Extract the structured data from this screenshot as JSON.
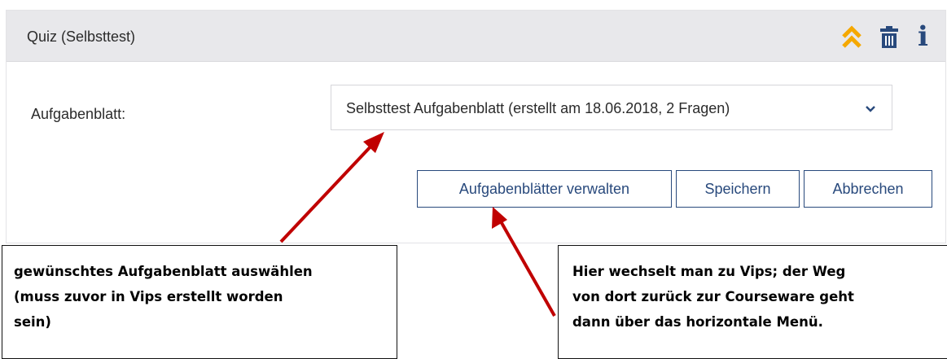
{
  "block": {
    "title": "Quiz (Selbsttest)",
    "icons": {
      "collapse": "double-chevron-up-icon",
      "delete": "trash-icon",
      "info": "info-icon",
      "info_glyph": "i"
    },
    "colors": {
      "collapse_icon": "#f5a800",
      "action_blue": "#28497c",
      "header_bg": "#e8e8eb"
    }
  },
  "form": {
    "label": "Aufgabenblatt:",
    "select_value": "Selbsttest Aufgabenblatt (erstellt am 18.06.2018, 2 Fragen)"
  },
  "buttons": {
    "manage": "Aufgabenblätter verwalten",
    "save": "Speichern",
    "cancel": "Abbrechen"
  },
  "annotations": {
    "left": {
      "lines": [
        "gewünschtes Aufgabenblatt auswählen",
        "(muss zuvor in Vips erstellt worden",
        "sein)"
      ]
    },
    "right": {
      "lines": [
        "Hier wechselt man zu Vips; der Weg",
        "von dort zurück zur Courseware geht",
        "dann über das horizontale Menü."
      ]
    },
    "arrow_color": "#c00000"
  }
}
